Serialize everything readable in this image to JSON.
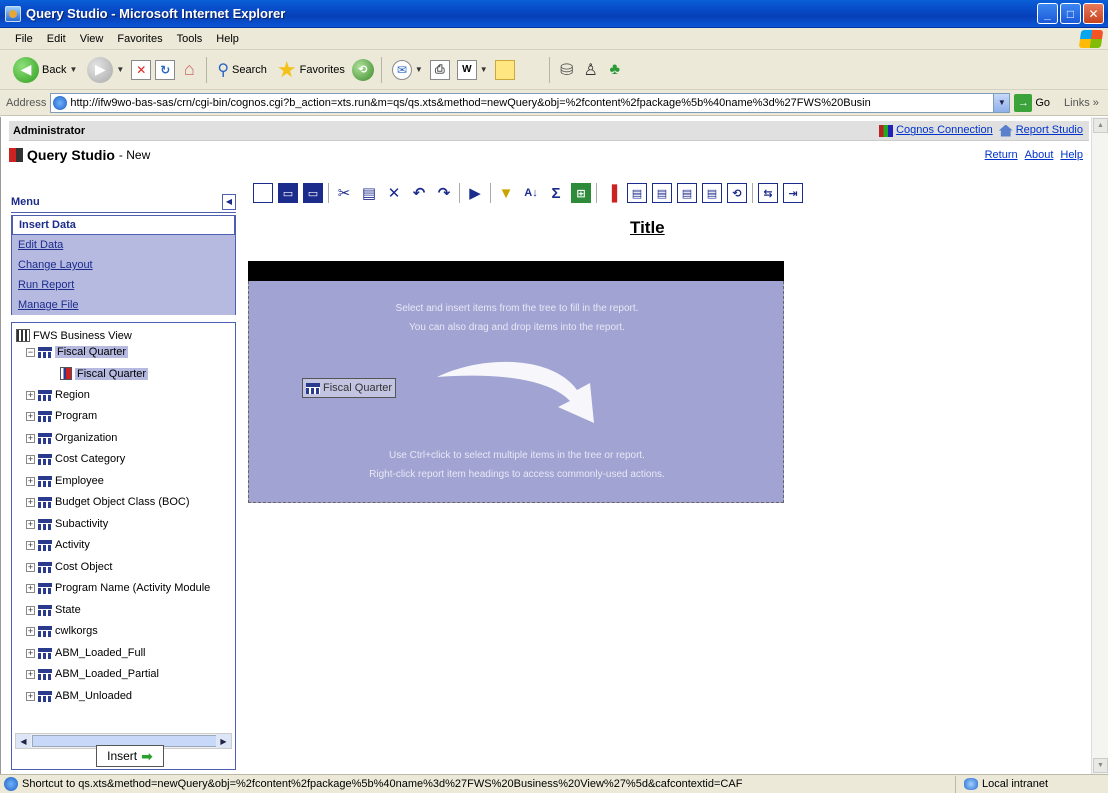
{
  "window": {
    "title": "Query Studio - Microsoft Internet Explorer",
    "buttons": {
      "minimize": "_",
      "maximize": "□",
      "close": "✕"
    }
  },
  "menubar": [
    "File",
    "Edit",
    "View",
    "Favorites",
    "Tools",
    "Help"
  ],
  "toolbar": {
    "back_label": "Back",
    "search_label": "Search",
    "favorites_label": "Favorites"
  },
  "address": {
    "label": "Address",
    "url": "http://ifw9wo-bas-sas/crn/cgi-bin/cognos.cgi?b_action=xts.run&m=qs/qs.xts&method=newQuery&obj=%2fcontent%2fpackage%5b%40name%3d%27FWS%20Busin",
    "go_label": "Go",
    "links_label": "Links"
  },
  "header": {
    "user": "Administrator",
    "cognos_connection": "Cognos Connection",
    "report_studio": "Report Studio",
    "app_title": "Query Studio",
    "app_subtitle": "- New",
    "return": "Return",
    "about": "About",
    "help": "Help"
  },
  "menu": {
    "title": "Menu",
    "items": [
      {
        "label": "Insert Data",
        "active": true
      },
      {
        "label": "Edit Data",
        "active": false
      },
      {
        "label": "Change Layout",
        "active": false
      },
      {
        "label": "Run Report",
        "active": false
      },
      {
        "label": "Manage File",
        "active": false
      }
    ]
  },
  "tree": {
    "root": "FWS Business View",
    "nodes": [
      {
        "label": "Fiscal Quarter",
        "expanded": true,
        "selected": true
      },
      {
        "label": "Fiscal Quarter",
        "child": true,
        "selected": true
      },
      {
        "label": "Region"
      },
      {
        "label": "Program"
      },
      {
        "label": "Organization"
      },
      {
        "label": "Cost Category"
      },
      {
        "label": "Employee"
      },
      {
        "label": "Budget Object Class (BOC)"
      },
      {
        "label": "Subactivity"
      },
      {
        "label": "Activity"
      },
      {
        "label": "Cost Object"
      },
      {
        "label": "Program Name (Activity Module"
      },
      {
        "label": "State"
      },
      {
        "label": "cwlkorgs"
      },
      {
        "label": "ABM_Loaded_Full"
      },
      {
        "label": "ABM_Loaded_Partial"
      },
      {
        "label": "ABM_Unloaded"
      }
    ],
    "insert_label": "Insert"
  },
  "report": {
    "title": "Title",
    "hint_lines_top": [
      "Select and insert items from the tree to fill in the report.",
      "You can also drag and drop items into the report."
    ],
    "drag_chip": "Fiscal Quarter",
    "hint_lines_bottom": [
      "Use Ctrl+click to select multiple items in the tree or report.",
      "Right-click report item headings to access commonly-used actions."
    ]
  },
  "statusbar": {
    "text": "Shortcut to qs.xts&method=newQuery&obj=%2fcontent%2fpackage%5b%40name%3d%27FWS%20Business%20View%27%5d&cafcontextid=CAF",
    "zone": "Local intranet"
  }
}
